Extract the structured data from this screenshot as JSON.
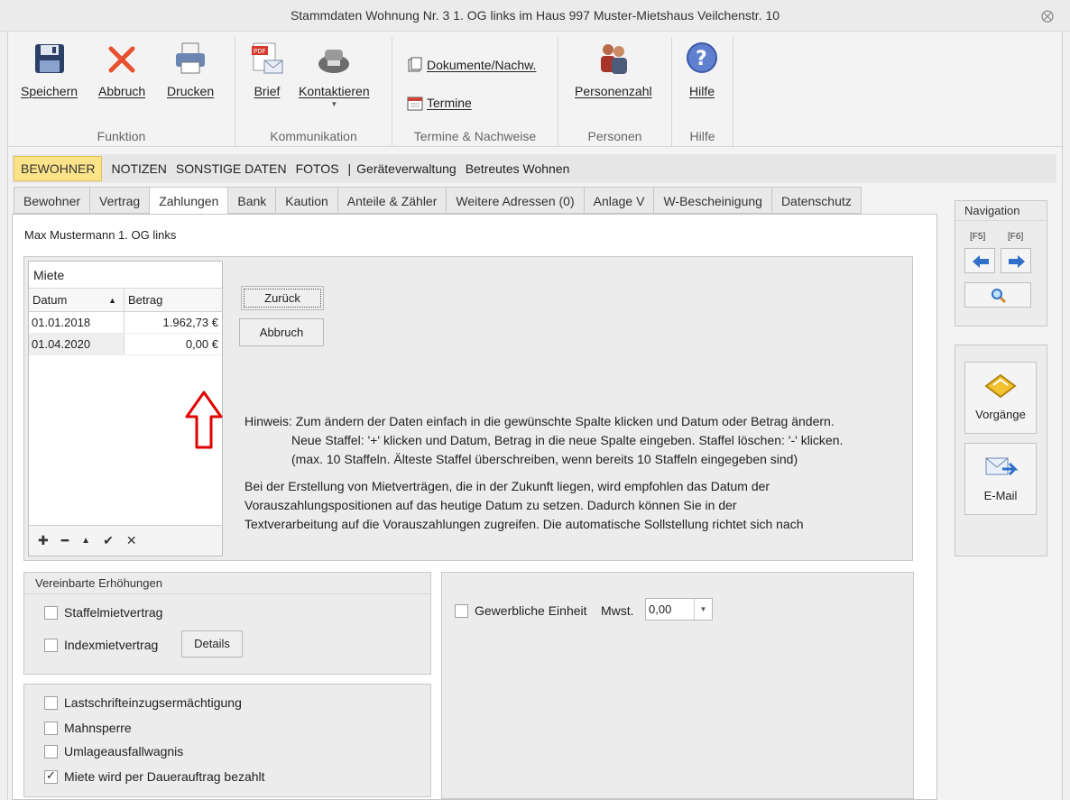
{
  "window": {
    "title": "Stammdaten Wohnung Nr. 3 1. OG links im Haus 997  Muster-Mietshaus Veilchenstr. 10",
    "close_glyph": "⨂"
  },
  "ribbon": {
    "funktion": {
      "name": "Funktion",
      "save": "Speichern",
      "cancel": "Abbruch",
      "print": "Drucken"
    },
    "kommunikation": {
      "name": "Kommunikation",
      "letter": "Brief",
      "contact": "Kontaktieren",
      "pdf_tag": "PDF"
    },
    "termine": {
      "name": "Termine & Nachweise",
      "documents": "Dokumente/Nachw.",
      "appointments": "Termine"
    },
    "personen": {
      "name": "Personen",
      "count": "Personenzahl"
    },
    "hilfe": {
      "name": "Hilfe",
      "help": "Hilfe"
    }
  },
  "subnav": {
    "items": [
      "BEWOHNER",
      "NOTIZEN",
      "SONSTIGE DATEN",
      "FOTOS",
      "|",
      "Geräteverwaltung",
      "Betreutes Wohnen"
    ],
    "active": "BEWOHNER"
  },
  "tabs": [
    "Bewohner",
    "Vertrag",
    "Zahlungen",
    "Bank",
    "Kaution",
    "Anteile & Zähler",
    "Weitere Adressen (0)",
    "Anlage V",
    "W-Bescheinigung",
    "Datenschutz"
  ],
  "selected_tab": "Zahlungen",
  "tenant": "Max Mustermann 1. OG links",
  "miete": {
    "title": "Miete",
    "columns": {
      "date": "Datum",
      "amount": "Betrag"
    },
    "sort_glyph": "▲",
    "rows": [
      {
        "date": "01.01.2018",
        "amount": "1.962,73 €"
      },
      {
        "date": "01.04.2020",
        "amount": "0,00 €"
      }
    ],
    "tools": [
      "✚",
      "━",
      "▲",
      "✔",
      "✕"
    ]
  },
  "buttons": {
    "back": "Zurück",
    "cancel": "Abbruch",
    "details": "Details"
  },
  "hint": {
    "line1": "Hinweis: Zum ändern der Daten einfach in die gewünschte Spalte klicken und Datum oder Betrag ändern.",
    "line2": "Neue Staffel: '+' klicken und Datum, Betrag in die neue Spalte eingeben. Staffel löschen: '-' klicken.",
    "line3": "(max. 10 Staffeln. Älteste Staffel überschreiben, wenn bereits 10 Staffeln eingegeben sind)",
    "para1": "Bei der Erstellung von Mietverträgen, die in der Zukunft liegen, wird empfohlen das Datum der",
    "para2": "Vorauszahlungspositionen auf das heutige Datum zu setzen. Dadurch können Sie in der",
    "para3": "Textverarbeitung auf die Vorauszahlungen zugreifen. Die automatische Sollstellung richtet sich nach"
  },
  "increases": {
    "title": "Vereinbarte Erhöhungen",
    "staffel": {
      "label": "Staffelmietvertrag",
      "checked": false
    },
    "index": {
      "label": "Indexmietvertrag",
      "checked": false
    }
  },
  "options": [
    {
      "label": "Lastschrifteinzugsermächtigung",
      "checked": false
    },
    {
      "label": "Mahnsperre",
      "checked": false
    },
    {
      "label": "Umlageausfallwagnis",
      "checked": false
    },
    {
      "label": "Miete wird per Dauerauftrag bezahlt",
      "checked": true
    }
  ],
  "commercial": {
    "label": "Gewerbliche Einheit",
    "checked": false,
    "vat_label": "Mwst.",
    "vat_value": "0,00"
  },
  "navigation": {
    "title": "Navigation",
    "prev_key": "[F5]",
    "next_key": "[F6]"
  },
  "side_actions": {
    "processes": "Vorgänge",
    "email": "E-Mail"
  },
  "colors": {
    "active_tab_bg": "#fce38a",
    "annotation_arrow": "#e00000",
    "accent_blue": "#2f6fc9"
  }
}
